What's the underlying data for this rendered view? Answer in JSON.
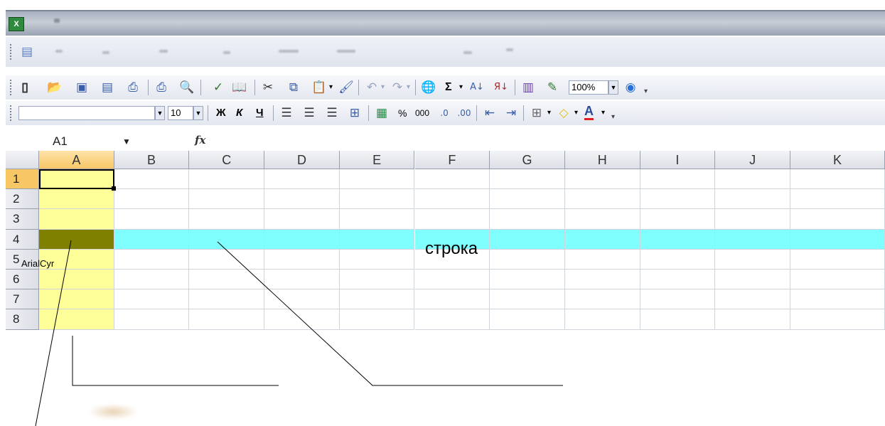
{
  "toolbar": {
    "zoom_value": "100%",
    "font_size_value": "10",
    "bold_label": "Ж",
    "italic_label": "К",
    "underline_label": "Ч",
    "percent_label": "%",
    "thousands_label": "000",
    "sigma_label": "Σ"
  },
  "formula_bar": {
    "name_box_value": "A1",
    "fx_label": "fx"
  },
  "sheet": {
    "columns": [
      "A",
      "B",
      "C",
      "D",
      "E",
      "F",
      "G",
      "H",
      "I",
      "J",
      "K"
    ],
    "rows": [
      "1",
      "2",
      "3",
      "4",
      "5",
      "6",
      "7",
      "8"
    ],
    "active_cell": "A1"
  },
  "annotations": {
    "row_label": "строка",
    "font_label": "ArialCyr"
  },
  "colors": {
    "column_highlight": "#ffff99",
    "row_highlight": "#80ffff",
    "intersection": "#808000"
  }
}
